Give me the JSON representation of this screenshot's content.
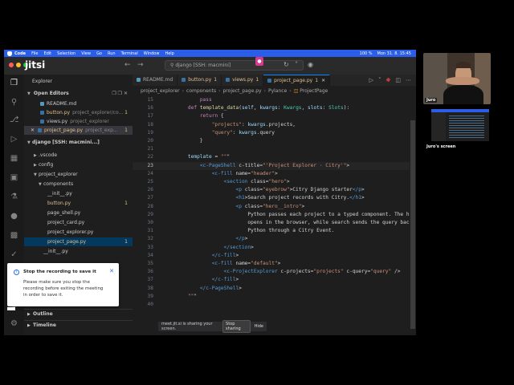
{
  "menubar": {
    "app": "Code",
    "items": [
      "File",
      "Edit",
      "Selection",
      "View",
      "Go",
      "Run",
      "Terminal",
      "Window",
      "Help"
    ],
    "battery": "100 %",
    "datetime": "Mon 31. 8. 15:45"
  },
  "titlebar": {
    "app_logo": "jitsi",
    "command_center": "django [SSH: macmini]",
    "record_badge": "●"
  },
  "sidebar": {
    "title": "Explorer",
    "open_editors": "Open Editors",
    "open_files": [
      {
        "name": "README.md",
        "desc": "",
        "count": ""
      },
      {
        "name": "button.py",
        "desc": "project_explorer/co...",
        "count": "1"
      },
      {
        "name": "views.py",
        "desc": "project_explorer",
        "count": ""
      },
      {
        "name": "project_page.py",
        "desc": "project_exp...",
        "count": "1"
      }
    ],
    "root": "django [SSH: macmini...]",
    "tree": [
      {
        "name": ".vscode",
        "count": ""
      },
      {
        "name": "config",
        "count": ""
      },
      {
        "name": "project_explorer",
        "count": ""
      },
      {
        "name": "components",
        "count": ""
      },
      {
        "name": "__init__.py",
        "count": ""
      },
      {
        "name": "button.py",
        "count": "1"
      },
      {
        "name": "page_shell.py",
        "count": ""
      },
      {
        "name": "project_card.py",
        "count": ""
      },
      {
        "name": "project_explorer.py",
        "count": ""
      },
      {
        "name": "project_page.py",
        "count": "1"
      },
      {
        "name": "__init__.py",
        "count": ""
      }
    ],
    "outline": "Outline",
    "timeline": "Timeline"
  },
  "tabs": [
    {
      "name": "README.md",
      "mod": ""
    },
    {
      "name": "button.py",
      "mod": "1"
    },
    {
      "name": "views.py",
      "mod": "1"
    },
    {
      "name": "project_page.py",
      "mod": "1"
    }
  ],
  "breadcrumb": [
    "project_explorer",
    "components",
    "project_page.py",
    "Pylance",
    "ProjectPage"
  ],
  "code_lines": [
    {
      "n": "15",
      "t": "        pass"
    },
    {
      "n": "16",
      "t": "    def template_data(self, kwargs: Kwargs, slots: Slots):"
    },
    {
      "n": "17",
      "t": "        return {"
    },
    {
      "n": "18",
      "t": "            \"projects\": kwargs.projects,"
    },
    {
      "n": "19",
      "t": "            \"query\": kwargs.query"
    },
    {
      "n": "20",
      "t": "        }"
    },
    {
      "n": "21",
      "t": ""
    },
    {
      "n": "22",
      "t": "    template = \"\"\""
    },
    {
      "n": "23",
      "t": "        <c-PageShell c-title=\"'Project Explorer · Citry'\">"
    },
    {
      "n": "24",
      "t": "            <c-fill name=\"header\">"
    },
    {
      "n": "25",
      "t": "                <section class=\"hero\">"
    },
    {
      "n": "26",
      "t": "                    <p class=\"eyebrow\">Citry Django starter</p>"
    },
    {
      "n": "27",
      "t": "                    <h1>Search project records with Citry.</h1>"
    },
    {
      "n": "28",
      "t": "                    <p class=\"hero__intro\">"
    },
    {
      "n": "29",
      "t": "                        Python passes each project to a typed component. The help"
    },
    {
      "n": "30",
      "t": "                        opens in the browser, while search sends the query back t"
    },
    {
      "n": "31",
      "t": "                        Python through a Citry Event."
    },
    {
      "n": "32",
      "t": "                    </p>"
    },
    {
      "n": "33",
      "t": "                </section>"
    },
    {
      "n": "34",
      "t": "            </c-fill>"
    },
    {
      "n": "35",
      "t": "            <c-fill name=\"default\">"
    },
    {
      "n": "36",
      "t": "                <c-ProjectExplorer c-projects=\"projects\" c-query=\"query\" />"
    },
    {
      "n": "37",
      "t": "            </c-fill>"
    },
    {
      "n": "38",
      "t": "        </c-PageShell>"
    },
    {
      "n": "39",
      "t": "    \"\"\""
    },
    {
      "n": "40",
      "t": ""
    }
  ],
  "share_bar": {
    "text": "meet.jit.si is sharing your screen.",
    "stop": "Stop sharing",
    "hide": "Hide"
  },
  "toast": {
    "title": "Stop the recording to save it",
    "body": "Please make sure you stop the recording before exiting the meeting in order to save it."
  },
  "participants": {
    "person": "Juro",
    "screen": "Juro's screen"
  }
}
